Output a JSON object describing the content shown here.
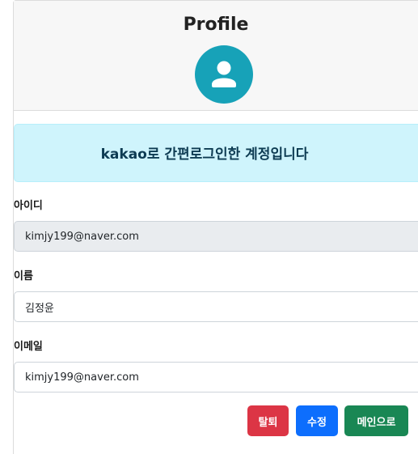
{
  "header": {
    "title": "Profile",
    "avatar_icon": "user-icon",
    "avatar_color": "#17a2b8"
  },
  "alert": {
    "text": "kakao로 간편로그인한 계정입니다"
  },
  "form": {
    "id_label": "아이디",
    "id_value": "kimjy199@naver.com",
    "name_label": "이름",
    "name_value": "김정윤",
    "email_label": "이메일",
    "email_value": "kimjy199@naver.com"
  },
  "buttons": {
    "withdraw": "탈퇴",
    "edit": "수정",
    "main": "메인으로"
  },
  "colors": {
    "danger": "#dc3545",
    "primary": "#0d6efd",
    "success": "#198754",
    "alert_bg": "#cff4fc"
  }
}
